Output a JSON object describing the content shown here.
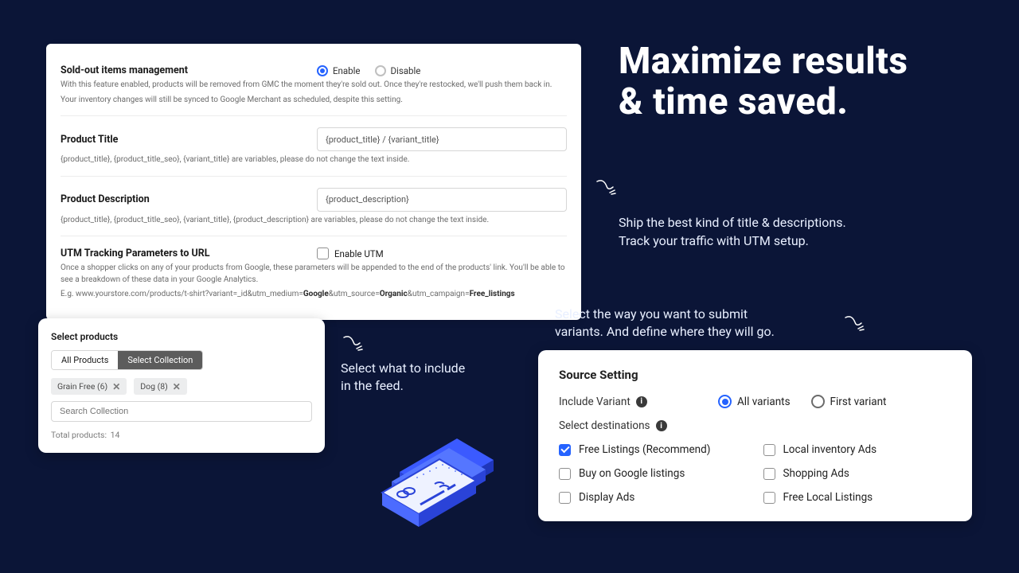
{
  "headline": {
    "line1": "Maximize results",
    "line2": "& time saved."
  },
  "captions": {
    "sub1_l1": "Ship the best kind of title & descriptions.",
    "sub1_l2": "Track your traffic with UTM setup.",
    "sub2_l1": "Select the way you want to submit",
    "sub2_l2": "variants. And define where they will go.",
    "sub3_l1": "Select what to include",
    "sub3_l2": "in the feed."
  },
  "settings": {
    "soldout": {
      "title": "Sold-out items management",
      "enable_label": "Enable",
      "disable_label": "Disable",
      "help1": "With this feature enabled, products will be removed from GMC the moment they're sold out. Once they're restocked, we'll push them back in.",
      "help2": "Your inventory changes will still be synced to Google Merchant as scheduled, despite this setting."
    },
    "product_title": {
      "title": "Product Title",
      "value": "{product_title} / {variant_title}",
      "help": "{product_title}, {product_title_seo}, {variant_title} are variables, please do not change the text inside."
    },
    "product_desc": {
      "title": "Product Description",
      "value": "{product_description}",
      "help": "{product_title}, {product_title_seo}, {variant_title}, {product_description} are variables, please do not change the text inside."
    },
    "utm": {
      "title": "UTM Tracking Parameters to URL",
      "enable_label": "Enable UTM",
      "help1": "Once a shopper clicks on any of your products from Google, these parameters will be appended to the end of the products' link. You'll be able to see a breakdown of these data in your Google Analytics.",
      "help2_prefix": "E.g. www.yourstore.com/products/t-shirt?variant=_id&utm_medium=",
      "help2_b1": "Google",
      "help2_mid1": "&utm_source=",
      "help2_b2": "Organic",
      "help2_mid2": "&utm_campaign=",
      "help2_b3": "Free_listings"
    }
  },
  "select_products": {
    "title": "Select products",
    "tab_all": "All Products",
    "tab_collection": "Select Collection",
    "chips": [
      {
        "label": "Grain Free (6)"
      },
      {
        "label": "Dog (8)"
      }
    ],
    "search_placeholder": "Search Collection",
    "total_label": "Total products:",
    "total_value": "14"
  },
  "source": {
    "title": "Source Setting",
    "include_variant_label": "Include Variant",
    "all_variants": "All variants",
    "first_variant": "First variant",
    "select_dest_label": "Select destinations",
    "destinations": {
      "free_listings": "Free Listings (Recommend)",
      "local_inv": "Local inventory Ads",
      "buy_google": "Buy on Google listings",
      "shopping_ads": "Shopping Ads",
      "display_ads": "Display Ads",
      "free_local": "Free Local Listings"
    }
  }
}
